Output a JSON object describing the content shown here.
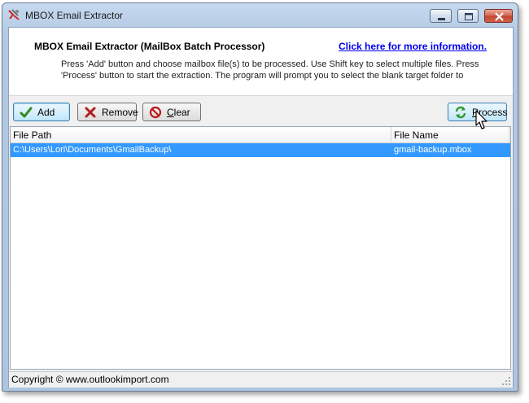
{
  "window": {
    "title": "MBOX Email Extractor"
  },
  "header": {
    "title": "MBOX Email Extractor (MailBox Batch Processor)",
    "link": "Click here for more information.",
    "instructions": "Press 'Add' button and choose mailbox file(s) to be processed. Use Shift key to select multiple files. Press 'Process' button to start the extraction. The program will prompt you to select the blank target folder to"
  },
  "toolbar": {
    "add": "Add",
    "remove": "Remove",
    "clear_first": "C",
    "clear_rest": "lear",
    "process_first": "P",
    "process_rest": "rocess"
  },
  "list": {
    "columns": [
      "File Path",
      "File Name"
    ],
    "rows": [
      {
        "path": "C:\\Users\\Lori\\Documents\\GmailBackup\\",
        "name": "gmail-backup.mbox",
        "selected": true
      }
    ]
  },
  "status": {
    "copyright": "Copyright © www.outlookimport.com"
  },
  "colors": {
    "selection": "#3399ff",
    "link": "#0000ee"
  },
  "icons": [
    "app-icon",
    "minimize-icon",
    "maximize-icon",
    "close-icon",
    "checkmark-icon",
    "x-icon",
    "no-sign-icon",
    "refresh-icon",
    "mouse-cursor-icon",
    "resize-grip-icon"
  ]
}
